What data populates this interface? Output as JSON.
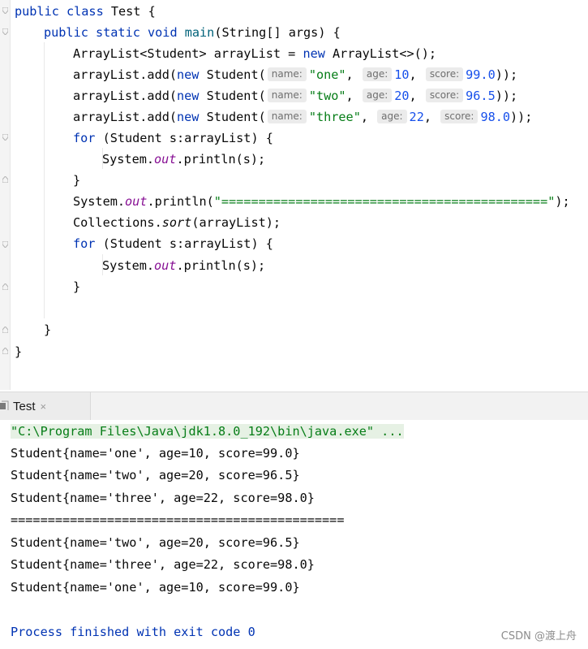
{
  "editor": {
    "lines": {
      "l1": {
        "a": "public class ",
        "b": "Test {"
      },
      "l2": {
        "a": "public static void ",
        "b": "main",
        "c": "(String[] args) {"
      },
      "l3": {
        "a": "ArrayList<Student> arrayList = ",
        "b": "new ",
        "c": "ArrayList<>();"
      },
      "l4": {
        "a": "arrayList.add(",
        "b": "new ",
        "c": "Student(",
        "h1": "name:",
        "s": "\"one\"",
        "p1": ", ",
        "h2": "age:",
        "n1": "10",
        "p2": ", ",
        "h3": "score:",
        "n2": "99.0",
        "e": "));"
      },
      "l5": {
        "a": "arrayList.add(",
        "b": "new ",
        "c": "Student(",
        "h1": "name:",
        "s": "\"two\"",
        "p1": ", ",
        "h2": "age:",
        "n1": "20",
        "p2": ", ",
        "h3": "score:",
        "n2": "96.5",
        "e": "));"
      },
      "l6": {
        "a": "arrayList.add(",
        "b": "new ",
        "c": "Student(",
        "h1": "name:",
        "s": "\"three\"",
        "p1": ", ",
        "h2": "age:",
        "n1": "22",
        "p2": ", ",
        "h3": "score:",
        "n2": "98.0",
        "e": "));"
      },
      "l7": {
        "a": "for ",
        "b": "(Student s:arrayList) {"
      },
      "l8": {
        "a": "System.",
        "b": "out",
        "c": ".println(s);"
      },
      "l9": {
        "a": "}"
      },
      "l10": {
        "a": "System.",
        "b": "out",
        "c": ".println(",
        "s": "\"============================================\"",
        "e": ");"
      },
      "l11": {
        "a": "Collections.",
        "b": "sort",
        "c": "(arrayList);"
      },
      "l12": {
        "a": "for ",
        "b": "(Student s:arrayList) {"
      },
      "l13": {
        "a": "System.",
        "b": "out",
        "c": ".println(s);"
      },
      "l14": {
        "a": "}"
      },
      "l15": {
        "a": "}"
      },
      "l16": {
        "a": "}"
      }
    }
  },
  "run_tab": {
    "label": "Test",
    "close": "×"
  },
  "console": {
    "command": "\"C:\\Program Files\\Java\\jdk1.8.0_192\\bin\\java.exe\" ...",
    "output": [
      "Student{name='one', age=10, score=99.0}",
      "Student{name='two', age=20, score=96.5}",
      "Student{name='three', age=22, score=98.0}",
      "=============================================",
      "Student{name='two', age=20, score=96.5}",
      "Student{name='three', age=22, score=98.0}",
      "Student{name='one', age=10, score=99.0}"
    ],
    "exit": "Process finished with exit code 0"
  },
  "watermark": "CSDN @渡上舟"
}
